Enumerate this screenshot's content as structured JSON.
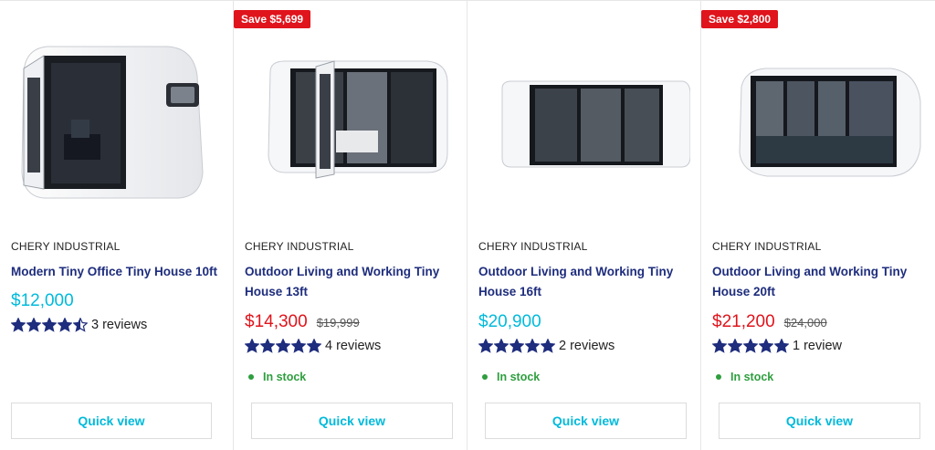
{
  "products": [
    {
      "vendor": "CHERY INDUSTRIAL",
      "title": "Modern Tiny Office Tiny House 10ft",
      "price": "$12,000",
      "price_type": "regular",
      "compare_price": "",
      "save_badge": "",
      "rating": 4.5,
      "reviews": "3 reviews",
      "stock": "",
      "quick_view": "Quick view",
      "image_icon": "office-pod-image"
    },
    {
      "vendor": "CHERY INDUSTRIAL",
      "title": "Outdoor Living and Working Tiny House 13ft",
      "price": "$14,300",
      "price_type": "sale",
      "compare_price": "$19,999",
      "save_badge": "Save $5,699",
      "rating": 5,
      "reviews": "4 reviews",
      "stock": "In stock",
      "quick_view": "Quick view",
      "image_icon": "bedroom-pod-image"
    },
    {
      "vendor": "CHERY INDUSTRIAL",
      "title": "Outdoor Living and Working Tiny House 16ft",
      "price": "$20,900",
      "price_type": "regular",
      "compare_price": "",
      "save_badge": "",
      "rating": 5,
      "reviews": "2 reviews",
      "stock": "In stock",
      "quick_view": "Quick view",
      "image_icon": "window-pod-image"
    },
    {
      "vendor": "CHERY INDUSTRIAL",
      "title": "Outdoor Living and Working Tiny House 20ft",
      "price": "$21,200",
      "price_type": "sale",
      "compare_price": "$24,000",
      "save_badge": "Save $2,800",
      "rating": 5,
      "reviews": "1 review",
      "stock": "In stock",
      "quick_view": "Quick view",
      "image_icon": "panoramic-pod-image"
    }
  ],
  "colors": {
    "accent": "#00badb",
    "sale": "#e0141c",
    "title": "#1e2d7d",
    "star": "#1e2d7d",
    "stock": "#2e9e3e"
  }
}
